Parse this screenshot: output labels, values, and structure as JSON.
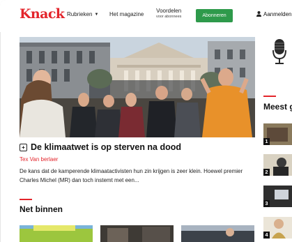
{
  "header": {
    "logo": "Knack",
    "nav": {
      "rubrieken": "Rubrieken",
      "magazine": "Het magazine",
      "voordelen": "Voordelen",
      "voordelen_sub": "voor abonnees"
    },
    "subscribe_label": "Abonneren",
    "login_label": "Aanmelden"
  },
  "hero": {
    "title": "De klimaatwet is op sterven na dood",
    "author": "Tex Van berlaer",
    "summary": "De kans dat de kamperende klimaatactivisten hun zin krijgen is zeer klein. Hoewel premier Charles Michel (MR) dan toch instemt met een..."
  },
  "net_binnen": {
    "title": "Net binnen"
  },
  "sidebar": {
    "title": "Meest gelezen",
    "items": [
      {
        "rank": "1"
      },
      {
        "rank": "2"
      },
      {
        "rank": "3"
      },
      {
        "rank": "4"
      }
    ]
  },
  "colors": {
    "brand": "#e3242b",
    "subscribe": "#2e9a4b"
  }
}
